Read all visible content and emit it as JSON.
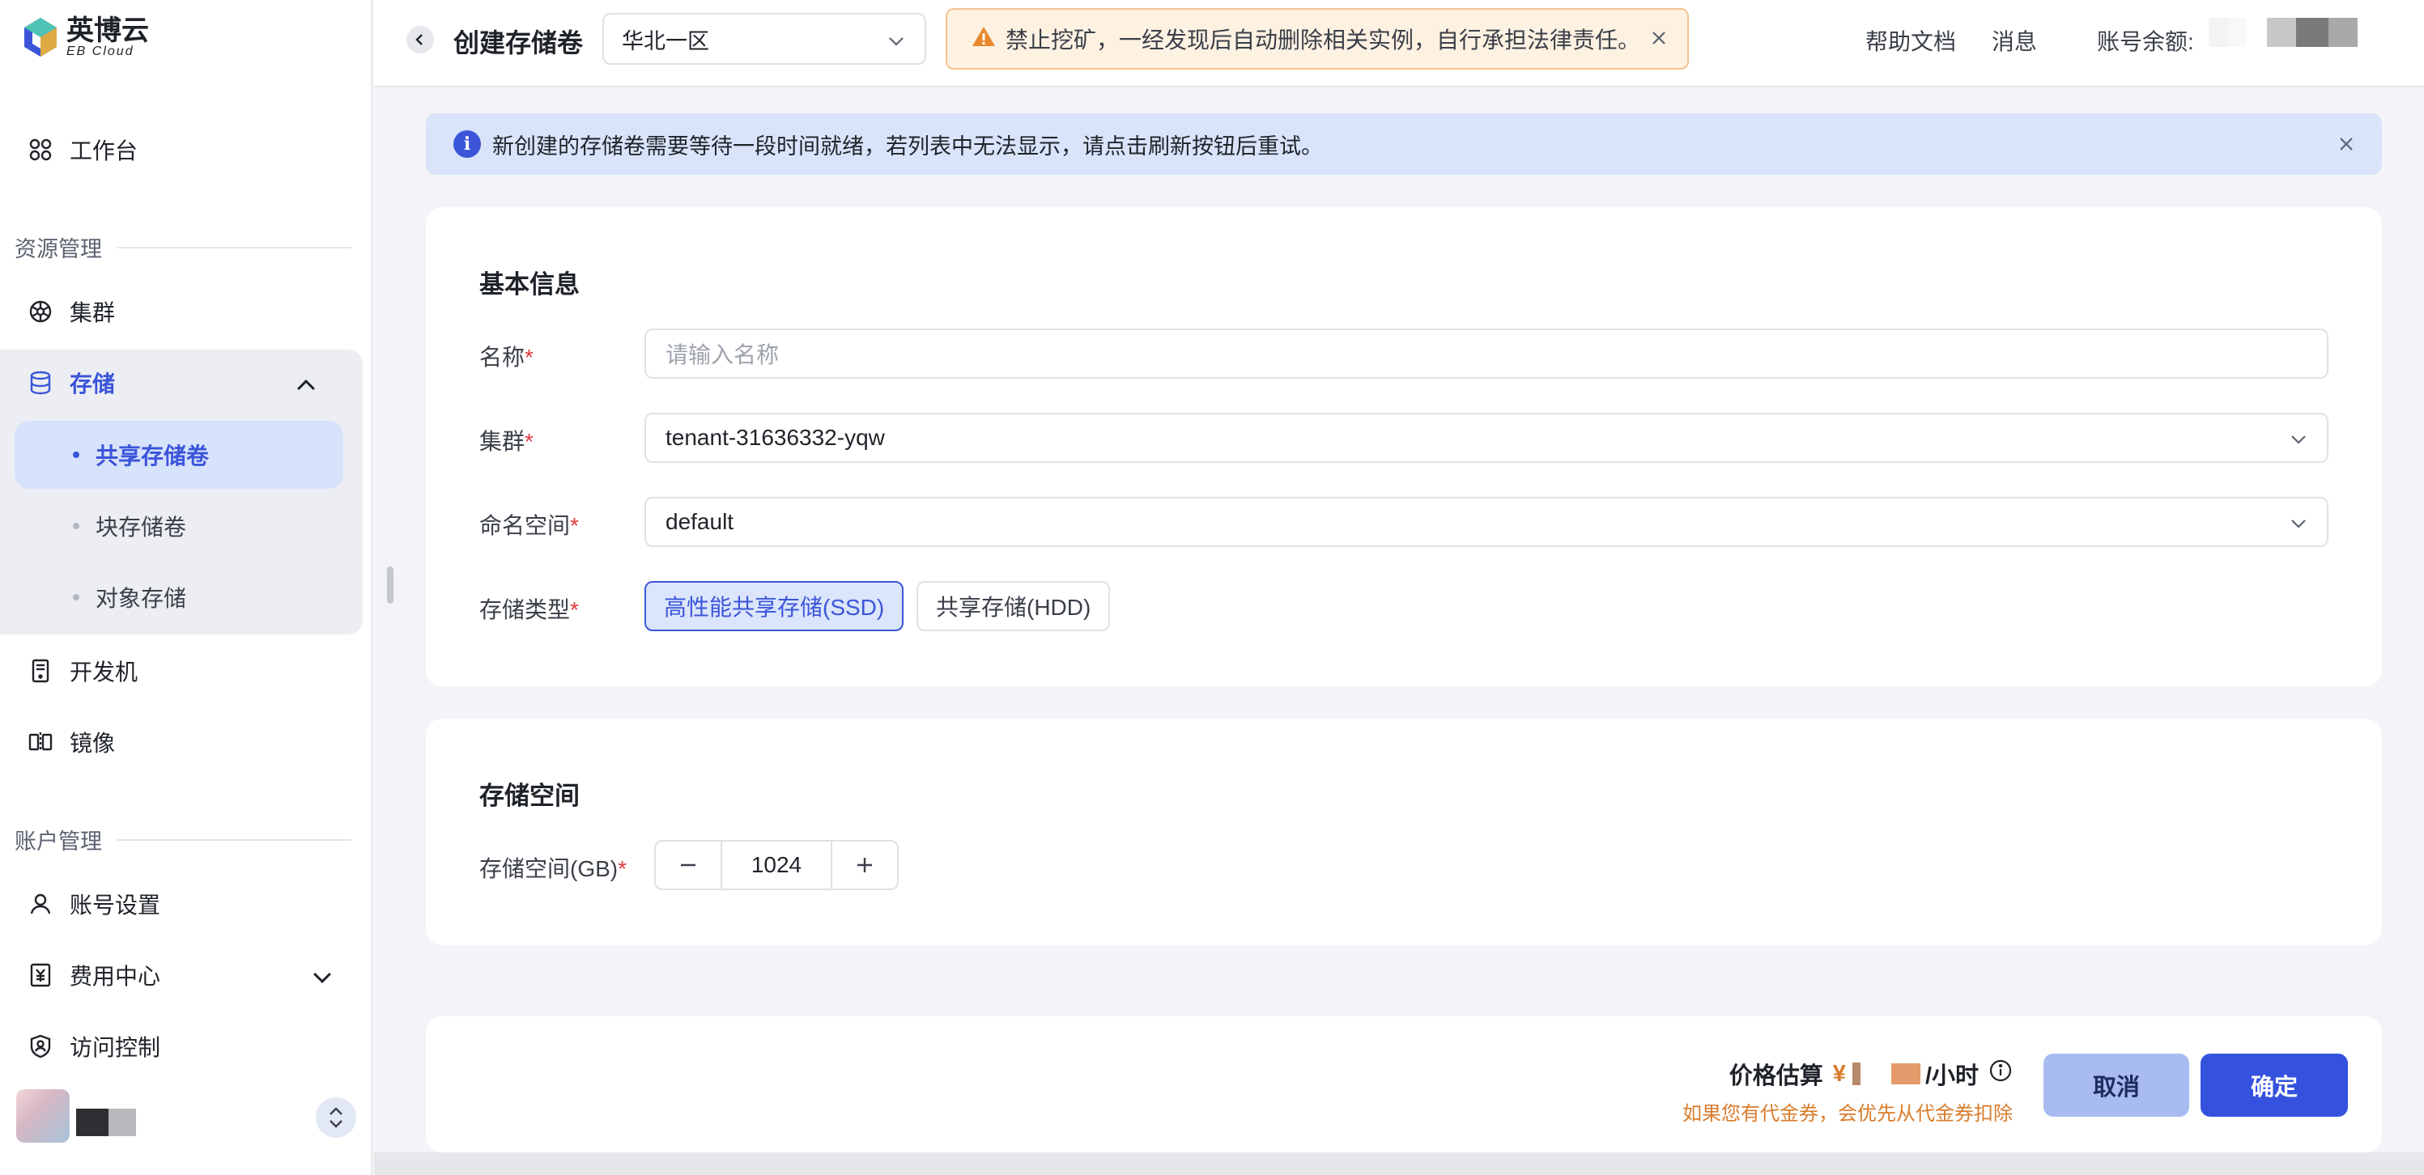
{
  "brand": {
    "name": "英博云",
    "sub": "EB Cloud",
    "colors": [
      "#3b55d9",
      "#4fc3b4",
      "#f2b430"
    ]
  },
  "sidebar": {
    "workbench": "工作台",
    "section_resources": "资源管理",
    "cluster": "集群",
    "storage": "存储",
    "storage_items": [
      {
        "label": "共享存储卷",
        "active": true
      },
      {
        "label": "块存储卷",
        "active": false
      },
      {
        "label": "对象存储",
        "active": false
      }
    ],
    "devmachine": "开发机",
    "image": "镜像",
    "section_account": "账户管理",
    "account_settings": "账号设置",
    "billing": "费用中心",
    "access_control": "访问控制"
  },
  "topbar": {
    "title": "创建存储卷",
    "region": "华北一区",
    "warning": "禁止挖矿，一经发现后自动删除相关实例，自行承担法律责任。",
    "help": "帮助文档",
    "messages": "消息",
    "balance_label": "账号余额:"
  },
  "info": {
    "text": "新创建的存储卷需要等待一段时间就绪，若列表中无法显示，请点击刷新按钮后重试。"
  },
  "basic": {
    "title": "基本信息",
    "name_label": "名称",
    "name_placeholder": "请输入名称",
    "cluster_label": "集群",
    "cluster_value": "tenant-31636332-yqw",
    "namespace_label": "命名空间",
    "namespace_value": "default",
    "type_label": "存储类型",
    "types": [
      {
        "label": "高性能共享存储(SSD)",
        "selected": true
      },
      {
        "label": "共享存储(HDD)",
        "selected": false
      }
    ]
  },
  "space": {
    "title": "存储空间",
    "label": "存储空间(GB)",
    "value": "1024"
  },
  "footer": {
    "price_label": "价格估算",
    "currency": "¥",
    "unit": "/小时",
    "note": "如果您有代金券，会优先从代金券扣除",
    "cancel": "取消",
    "confirm": "确定"
  },
  "required_mark": "*"
}
